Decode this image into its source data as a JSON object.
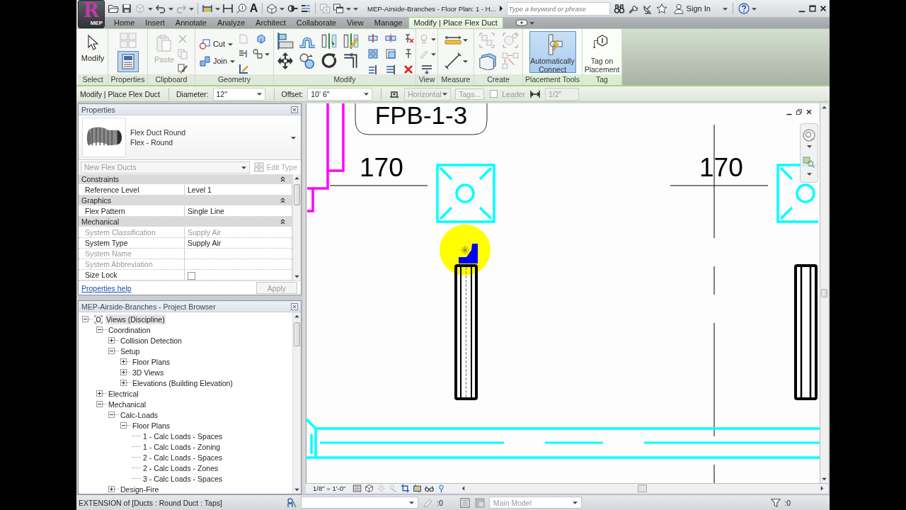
{
  "app_menu": {
    "letter": "R",
    "badge": "MEP"
  },
  "title_bar": {
    "text_tool_glyph": "A",
    "title": "MEP-Airside-Branches - Floor Plan: 1 - H...",
    "search": {
      "placeholder": "Type a keyword or phrase"
    },
    "sign_in": "Sign In"
  },
  "tabs": [
    {
      "label": "Home",
      "selected": false
    },
    {
      "label": "Insert",
      "selected": false
    },
    {
      "label": "Annotate",
      "selected": false
    },
    {
      "label": "Analyze",
      "selected": false
    },
    {
      "label": "Architect",
      "selected": false
    },
    {
      "label": "Collaborate",
      "selected": false
    },
    {
      "label": "View",
      "selected": false
    },
    {
      "label": "Manage",
      "selected": false
    },
    {
      "label": "Modify | Place Flex Duct",
      "selected": true
    }
  ],
  "ribbon_panels": [
    {
      "kind": "select",
      "title": "Select",
      "buttons": [
        {
          "label": "Modify"
        }
      ]
    },
    {
      "kind": "properties",
      "title": "Properties",
      "buttons": [
        {
          "selected": true
        }
      ]
    },
    {
      "kind": "clipboard",
      "title": "Clipboard",
      "buttons": [
        {
          "label": "Paste",
          "disabled": true
        }
      ]
    },
    {
      "kind": "geometry",
      "title": "Geometry",
      "buttons": [
        {
          "label": "Cut"
        },
        {
          "label": "Join"
        }
      ]
    },
    {
      "kind": "modify",
      "title": "Modify"
    },
    {
      "kind": "view",
      "title": "View"
    },
    {
      "kind": "measure",
      "title": "Measure"
    },
    {
      "kind": "create",
      "title": "Create"
    },
    {
      "kind": "placement",
      "title": "Placement Tools",
      "buttons": [
        {
          "label": "Automatically Connect",
          "selected": true
        }
      ]
    },
    {
      "kind": "tag",
      "title": "Tag",
      "buttons": [
        {
          "label": "Tag on Placement",
          "selected": false
        }
      ]
    }
  ],
  "options_bar": {
    "mode": "Modify | Place Flex Duct",
    "diameter": {
      "label": "Diameter:",
      "value": "12\""
    },
    "offset": {
      "label": "Offset:",
      "value": "10' 6\""
    },
    "justification": {
      "value": "Horizontal",
      "disabled": true
    },
    "tags": {
      "label": "Tags...",
      "disabled": true
    },
    "leader": {
      "label": "Leader",
      "checked": false,
      "disabled": true
    },
    "length": {
      "value": "1/2\"",
      "disabled": true
    }
  },
  "properties": {
    "title": "Properties",
    "type_name": "Flex Duct Round",
    "type_subname": "Flex - Round",
    "filter": {
      "value": "New Flex Ducts",
      "disabled": true
    },
    "edit_type": {
      "label": "Edit Type",
      "disabled": true
    },
    "groups": [
      {
        "name": "Constraints",
        "expanded": true,
        "rows": [
          {
            "kind": "text",
            "label": "Reference Level",
            "value": "Level 1",
            "disabled": false
          }
        ]
      },
      {
        "name": "Graphics",
        "expanded": true,
        "rows": [
          {
            "kind": "text",
            "label": "Flex Pattern",
            "value": "Single Line",
            "disabled": false
          }
        ]
      },
      {
        "name": "Mechanical",
        "expanded": true,
        "rows": [
          {
            "kind": "text",
            "label": "System Classification",
            "value": "Supply Air",
            "disabled": true
          },
          {
            "kind": "text",
            "label": "System Type",
            "value": "Supply Air",
            "disabled": false
          },
          {
            "kind": "text",
            "label": "System Name",
            "disabled": true
          },
          {
            "kind": "text",
            "label": "System Abbreviation",
            "disabled": true
          },
          {
            "kind": "checkbox",
            "label": "Size Lock",
            "checked": false,
            "disabled": false
          }
        ]
      }
    ],
    "help_link": "Properties help",
    "apply": {
      "label": "Apply",
      "disabled": true
    }
  },
  "project_browser": {
    "title": "MEP-Airside-Branches - Project Browser",
    "tree": [
      {
        "label": "Views (Discipline)",
        "selected": true,
        "expanded": true,
        "children": [
          {
            "label": "Coordination",
            "selected": false,
            "expanded": true,
            "children": [
              {
                "label": "Collision Detection",
                "selected": false,
                "expanded": false
              },
              {
                "label": "Setup",
                "selected": false,
                "expanded": true,
                "children": [
                  {
                    "label": "Floor Plans",
                    "selected": false,
                    "expanded": false
                  },
                  {
                    "label": "3D Views",
                    "selected": false,
                    "expanded": false
                  },
                  {
                    "label": "Elevations (Building Elevation)",
                    "selected": false,
                    "expanded": false
                  }
                ]
              }
            ]
          },
          {
            "label": "Electrical",
            "selected": false,
            "expanded": false
          },
          {
            "label": "Mechanical",
            "selected": false,
            "expanded": true,
            "children": [
              {
                "label": "Calc-Loads",
                "selected": false,
                "expanded": true,
                "children": [
                  {
                    "label": "Floor Plans",
                    "selected": false,
                    "expanded": true,
                    "children": [
                      {
                        "label": "1 - Calc Loads - Spaces",
                        "selected": false
                      },
                      {
                        "label": "1 - Calc Loads - Zoning",
                        "selected": false
                      },
                      {
                        "label": "2 - Calc Loads - Spaces",
                        "selected": false
                      },
                      {
                        "label": "2 - Calc Loads - Zones",
                        "selected": false
                      },
                      {
                        "label": "3 - Calc Loads - Spaces",
                        "selected": false
                      }
                    ]
                  }
                ]
              },
              {
                "label": "Design-Fire",
                "selected": false,
                "expanded": false
              }
            ]
          }
        ]
      }
    ]
  },
  "view": {
    "drawing": {
      "tag": "FPB-1-3",
      "numbers": [
        "170",
        "170"
      ]
    },
    "scale": "1/8\" = 1'-0\""
  },
  "status_bar": {
    "message": "EXTENSION of [Ducts : Round Duct : Taps]",
    "editable_count": ":0",
    "design_option": {
      "value": "Main Model",
      "disabled": true
    },
    "filter_count": ":0"
  }
}
